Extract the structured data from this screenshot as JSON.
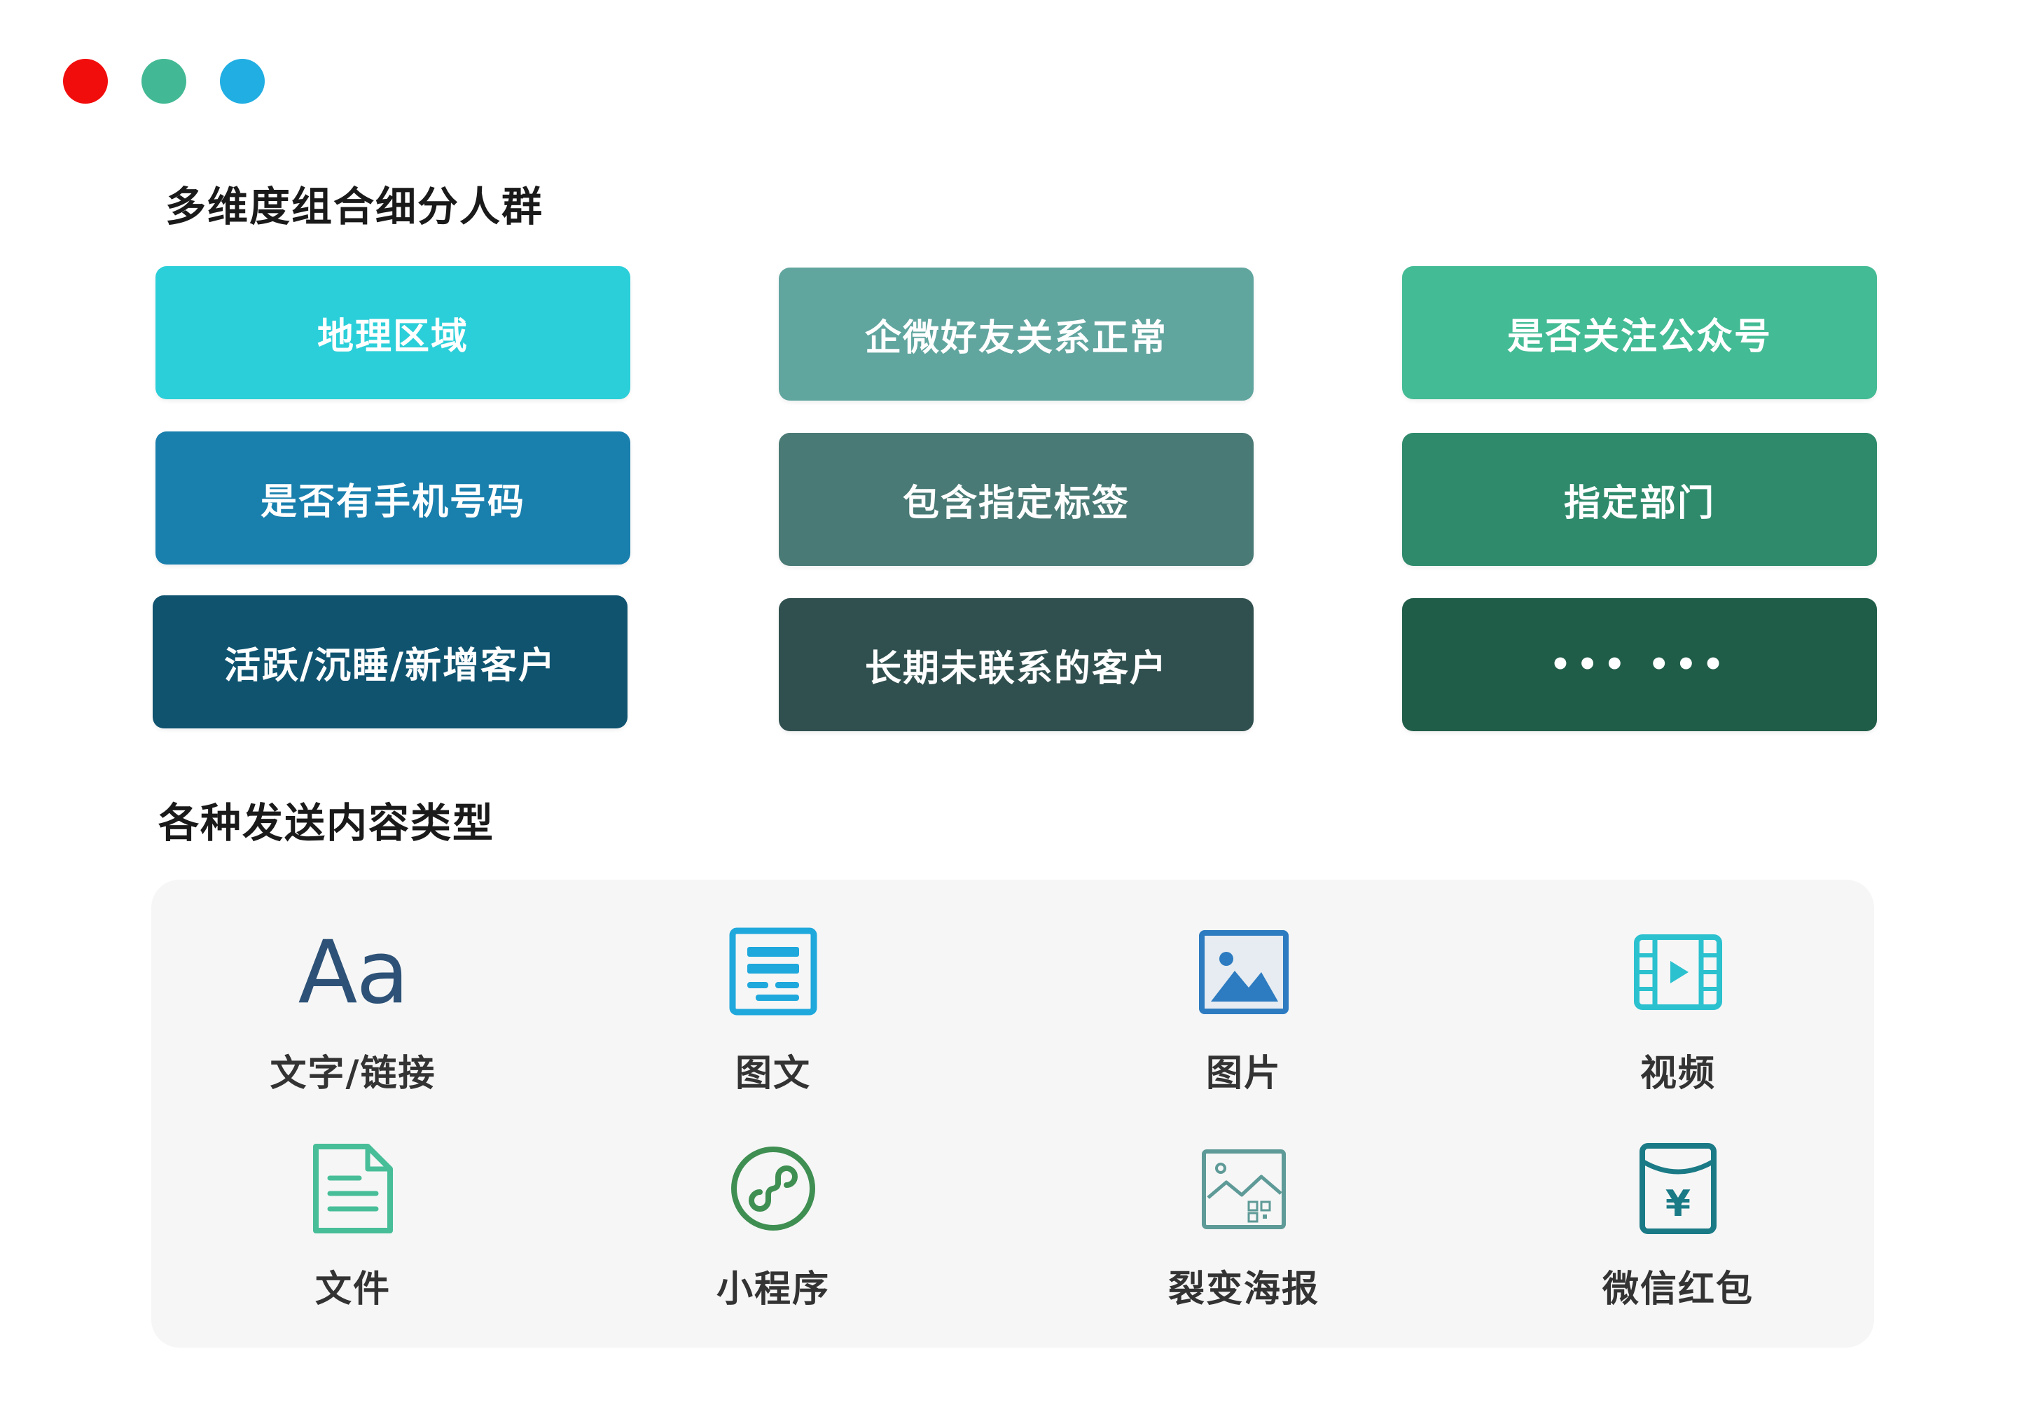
{
  "window_controls": {
    "colors": [
      "#f20d0d",
      "#42b994",
      "#20aee3"
    ]
  },
  "sections": {
    "segments_title": "多维度组合细分人群",
    "content_title": "各种发送内容类型"
  },
  "segments": [
    {
      "label": "地理区域",
      "color": "#2bcfd9"
    },
    {
      "label": "企微好友关系正常",
      "color": "#61a59f"
    },
    {
      "label": "是否关注公众号",
      "color": "#43bb94"
    },
    {
      "label": "是否有手机号码",
      "color": "#197fad"
    },
    {
      "label": "包含指定标签",
      "color": "#4a7a75"
    },
    {
      "label": "指定部门",
      "color": "#2e8a6b"
    },
    {
      "label": "活跃/沉睡/新增客户",
      "color": "#0f536f"
    },
    {
      "label": "长期未联系的客户",
      "color": "#30504f"
    },
    {
      "label": "••• •••",
      "color": "#205d48"
    }
  ],
  "content_types": [
    {
      "label": "文字/链接",
      "icon": "text-icon",
      "glyph": "Aa",
      "color": "#2e5277"
    },
    {
      "label": "图文",
      "icon": "article-icon",
      "color": "#1fa8dc"
    },
    {
      "label": "图片",
      "icon": "image-icon",
      "color": "#2d7bc0"
    },
    {
      "label": "视频",
      "icon": "video-icon",
      "color": "#2bc1cf"
    },
    {
      "label": "文件",
      "icon": "file-icon",
      "color": "#47be98"
    },
    {
      "label": "小程序",
      "icon": "mini-program-icon",
      "color": "#3f8f52"
    },
    {
      "label": "裂变海报",
      "icon": "poster-icon",
      "color": "#5e9a97"
    },
    {
      "label": "微信红包",
      "icon": "red-packet-icon",
      "glyph": "¥",
      "color": "#1a7a86"
    }
  ]
}
